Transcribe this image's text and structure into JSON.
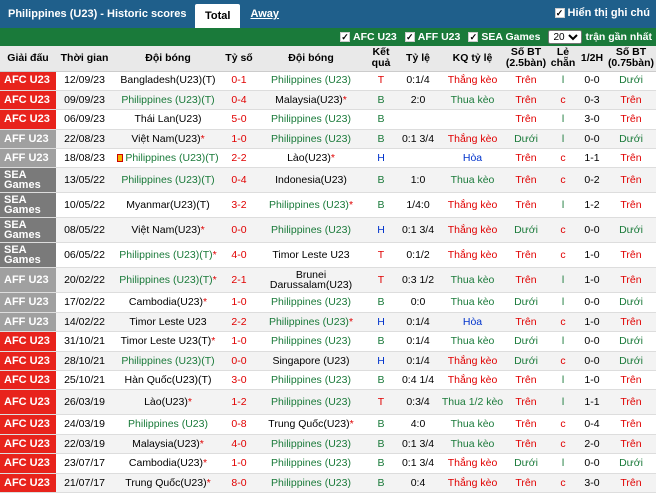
{
  "header": {
    "title": "Philippines (U23) - Historic scores",
    "tabs": [
      "Total",
      "Away"
    ],
    "show_notes": "Hiển thị ghi chú"
  },
  "filters": {
    "leagues": [
      "AFC U23",
      "AFF U23",
      "SEA Games"
    ],
    "count": "20",
    "recent_label": "trận gần nhất"
  },
  "columns": [
    "Giải đấu",
    "Thời gian",
    "Đội bóng",
    "Tỷ số",
    "Đội bóng",
    "Kết quả",
    "Tỷ lệ",
    "KQ tỷ lệ",
    "Số BT (2.5bàn)",
    "Lẻ chẵn",
    "1/2H",
    "Số BT (0.75bàn)"
  ],
  "league_colors": {
    "AFC U23": "#e8231c",
    "AFF U23": "#a0a0a0",
    "SEA Games": "#7a7a7a"
  },
  "rows": [
    {
      "league": "AFC U23",
      "date": "12/09/23",
      "home": "Bangladesh(U23)(T)",
      "home_mark": "",
      "home_phil": false,
      "score": "0-1",
      "away": "Philippines (U23)",
      "away_phil": true,
      "away_mark": "",
      "result": "T",
      "odds": "0:1/4",
      "oddres": "Thắng kèo",
      "ou": "Trên",
      "oe": "l",
      "half": "0-0",
      "ou2": "Dưới",
      "tall": false
    },
    {
      "league": "AFC U23",
      "date": "09/09/23",
      "home": "Philippines (U23)(T)",
      "home_mark": "",
      "home_phil": true,
      "score": "0-4",
      "away": "Malaysia(U23)",
      "away_phil": false,
      "away_mark": "*",
      "result": "B",
      "odds": "2:0",
      "oddres": "Thua kèo",
      "ou": "Trên",
      "oe": "c",
      "half": "0-3",
      "ou2": "Trên",
      "tall": false
    },
    {
      "league": "AFC U23",
      "date": "06/09/23",
      "home": "Thái Lan(U23)",
      "home_mark": "",
      "home_phil": false,
      "score": "5-0",
      "away": "Philippines (U23)",
      "away_phil": true,
      "away_mark": "",
      "result": "B",
      "odds": "",
      "oddres": "",
      "ou": "Trên",
      "oe": "l",
      "half": "3-0",
      "ou2": "Trên",
      "tall": false
    },
    {
      "league": "AFF U23",
      "date": "22/08/23",
      "home": "Việt Nam(U23)",
      "home_mark": "*",
      "home_phil": false,
      "score": "1-0",
      "away": "Philippines (U23)",
      "away_phil": true,
      "away_mark": "",
      "result": "B",
      "odds": "0:1 3/4",
      "oddres": "Thắng kèo",
      "ou": "Dưới",
      "oe": "l",
      "half": "0-0",
      "ou2": "Dưới",
      "tall": false
    },
    {
      "league": "AFF U23",
      "date": "18/08/23",
      "home": "Philippines (U23)(T)",
      "home_mark": "",
      "home_phil": true,
      "flag": true,
      "score": "2-2",
      "away": "Lào(U23)",
      "away_phil": false,
      "away_mark": "*",
      "result": "H",
      "odds": "",
      "oddres": "Hòa",
      "ou": "Trên",
      "oe": "c",
      "half": "1-1",
      "ou2": "Trên",
      "tall": false
    },
    {
      "league": "SEA Games",
      "date": "13/05/22",
      "home": "Philippines (U23)(T)",
      "home_mark": "",
      "home_phil": true,
      "score": "0-4",
      "away": "Indonesia(U23)",
      "away_phil": false,
      "away_mark": "",
      "result": "B",
      "odds": "1:0",
      "oddres": "Thua kèo",
      "ou": "Trên",
      "oe": "c",
      "half": "0-2",
      "ou2": "Trên",
      "tall": true
    },
    {
      "league": "SEA Games",
      "date": "10/05/22",
      "home": "Myanmar(U23)(T)",
      "home_mark": "",
      "home_phil": false,
      "score": "3-2",
      "away": "Philippines (U23)",
      "away_phil": true,
      "away_mark": "*",
      "result": "B",
      "odds": "1/4:0",
      "oddres": "Thắng kèo",
      "ou": "Trên",
      "oe": "l",
      "half": "1-2",
      "ou2": "Trên",
      "tall": true
    },
    {
      "league": "SEA Games",
      "date": "08/05/22",
      "home": "Việt Nam(U23)",
      "home_mark": "*",
      "home_phil": false,
      "score": "0-0",
      "away": "Philippines (U23)",
      "away_phil": true,
      "away_mark": "",
      "result": "H",
      "odds": "0:1 3/4",
      "oddres": "Thắng kèo",
      "ou": "Dưới",
      "oe": "c",
      "half": "0-0",
      "ou2": "Dưới",
      "tall": true
    },
    {
      "league": "SEA Games",
      "date": "06/05/22",
      "home": "Philippines (U23)(T)",
      "home_mark": "*",
      "home_phil": true,
      "score": "4-0",
      "away": "Timor Leste U23",
      "away_phil": false,
      "away_mark": "",
      "result": "T",
      "odds": "0:1/2",
      "oddres": "Thắng kèo",
      "ou": "Trên",
      "oe": "c",
      "half": "1-0",
      "ou2": "Trên",
      "tall": true
    },
    {
      "league": "AFF U23",
      "date": "20/02/22",
      "home": "Philippines (U23)(T)",
      "home_mark": "*",
      "home_phil": true,
      "score": "2-1",
      "away": "Brunei Darussalam(U23)",
      "away_phil": false,
      "away_mark": "",
      "result": "T",
      "odds": "0:3 1/2",
      "oddres": "Thua kèo",
      "ou": "Trên",
      "oe": "l",
      "half": "1-0",
      "ou2": "Trên",
      "tall": true
    },
    {
      "league": "AFF U23",
      "date": "17/02/22",
      "home": "Cambodia(U23)",
      "home_mark": "*",
      "home_phil": false,
      "score": "1-0",
      "away": "Philippines (U23)",
      "away_phil": true,
      "away_mark": "",
      "result": "B",
      "odds": "0:0",
      "oddres": "Thua kèo",
      "ou": "Dưới",
      "oe": "l",
      "half": "0-0",
      "ou2": "Dưới",
      "tall": false
    },
    {
      "league": "AFF U23",
      "date": "14/02/22",
      "home": "Timor Leste U23",
      "home_mark": "",
      "home_phil": false,
      "score": "2-2",
      "away": "Philippines (U23)",
      "away_phil": true,
      "away_mark": "*",
      "result": "H",
      "odds": "0:1/4",
      "oddres": "Hòa",
      "ou": "Trên",
      "oe": "c",
      "half": "1-0",
      "ou2": "Trên",
      "tall": false
    },
    {
      "league": "AFC U23",
      "date": "31/10/21",
      "home": "Timor Leste U23(T)",
      "home_mark": "*",
      "home_phil": false,
      "score": "1-0",
      "away": "Philippines (U23)",
      "away_phil": true,
      "away_mark": "",
      "result": "B",
      "odds": "0:1/4",
      "oddres": "Thua kèo",
      "ou": "Dưới",
      "oe": "l",
      "half": "0-0",
      "ou2": "Dưới",
      "tall": false
    },
    {
      "league": "AFC U23",
      "date": "28/10/21",
      "home": "Philippines (U23)(T)",
      "home_mark": "",
      "home_phil": true,
      "score": "0-0",
      "away": "Singapore (U23)",
      "away_phil": false,
      "away_mark": "",
      "result": "H",
      "odds": "0:1/4",
      "oddres": "Thắng kèo",
      "ou": "Dưới",
      "oe": "c",
      "half": "0-0",
      "ou2": "Dưới",
      "tall": false
    },
    {
      "league": "AFC U23",
      "date": "25/10/21",
      "home": "Hàn Quốc(U23)(T)",
      "home_mark": "",
      "home_phil": false,
      "score": "3-0",
      "away": "Philippines (U23)",
      "away_phil": true,
      "away_mark": "",
      "result": "B",
      "odds": "0:4 1/4",
      "oddres": "Thắng kèo",
      "ou": "Trên",
      "oe": "l",
      "half": "1-0",
      "ou2": "Trên",
      "tall": false
    },
    {
      "league": "AFC U23",
      "date": "26/03/19",
      "home": "Lào(U23)",
      "home_mark": "*",
      "home_phil": false,
      "score": "1-2",
      "away": "Philippines (U23)",
      "away_phil": true,
      "away_mark": "",
      "result": "T",
      "odds": "0:3/4",
      "oddres": "Thua 1/2 kèo",
      "ou": "Trên",
      "oe": "l",
      "half": "1-1",
      "ou2": "Trên",
      "tall": true
    },
    {
      "league": "AFC U23",
      "date": "24/03/19",
      "home": "Philippines (U23)",
      "home_mark": "",
      "home_phil": true,
      "score": "0-8",
      "away": "Trung Quốc(U23)",
      "away_phil": false,
      "away_mark": "*",
      "result": "B",
      "odds": "4:0",
      "oddres": "Thua kèo",
      "ou": "Trên",
      "oe": "c",
      "half": "0-4",
      "ou2": "Trên",
      "tall": false
    },
    {
      "league": "AFC U23",
      "date": "22/03/19",
      "home": "Malaysia(U23)",
      "home_mark": "*",
      "home_phil": false,
      "score": "4-0",
      "away": "Philippines (U23)",
      "away_phil": true,
      "away_mark": "",
      "result": "B",
      "odds": "0:1 3/4",
      "oddres": "Thua kèo",
      "ou": "Trên",
      "oe": "c",
      "half": "2-0",
      "ou2": "Trên",
      "tall": false
    },
    {
      "league": "AFC U23",
      "date": "23/07/17",
      "home": "Cambodia(U23)",
      "home_mark": "*",
      "home_phil": false,
      "score": "1-0",
      "away": "Philippines (U23)",
      "away_phil": true,
      "away_mark": "",
      "result": "B",
      "odds": "0:1 3/4",
      "oddres": "Thắng kèo",
      "ou": "Dưới",
      "oe": "l",
      "half": "0-0",
      "ou2": "Dưới",
      "tall": false
    },
    {
      "league": "AFC U23",
      "date": "21/07/17",
      "home": "Trung Quốc(U23)",
      "home_mark": "*",
      "home_phil": false,
      "score": "8-0",
      "away": "Philippines (U23)",
      "away_phil": true,
      "away_mark": "",
      "result": "B",
      "odds": "0:4",
      "oddres": "Thắng kèo",
      "ou": "Trên",
      "oe": "c",
      "half": "3-0",
      "ou2": "Trên",
      "tall": false
    }
  ]
}
